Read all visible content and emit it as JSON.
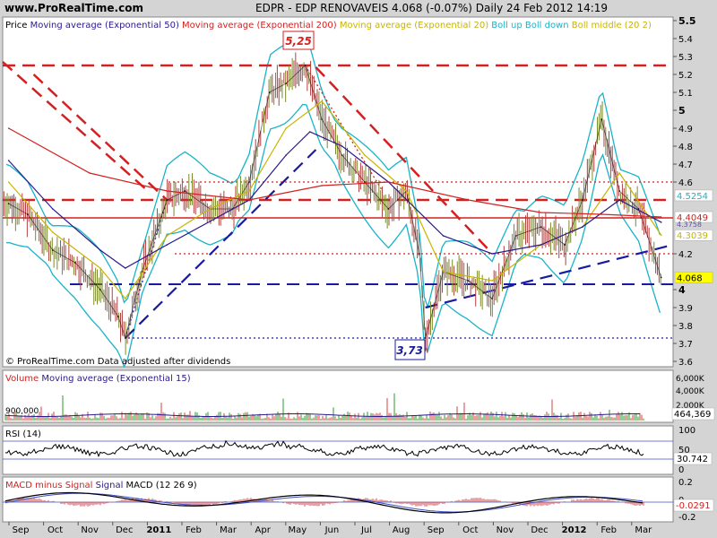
{
  "header": {
    "site": "www.ProRealTime.com",
    "title": "EDPR - EDP RENOVAVEIS    4.068 (-0.07%)    Daily  24 Feb 2012 14:19"
  },
  "price_panel": {
    "legend": [
      {
        "text": "Price",
        "color": "#000000"
      },
      {
        "text": "Moving average (Exponential 50)",
        "color": "#2a1a8a"
      },
      {
        "text": "Moving average (Exponential 200)",
        "color": "#d42020"
      },
      {
        "text": "Moving average (Exponential 20)",
        "color": "#c8b400"
      },
      {
        "text": "Boll up",
        "color": "#18b4c8"
      },
      {
        "text": "Boll down",
        "color": "#18b4c8"
      },
      {
        "text": "Boll middle (20 2)",
        "color": "#c8b400"
      }
    ],
    "footer": "© ProRealTime.com  Data adjusted after dividends",
    "annotations": {
      "high": "5,25",
      "low": "3,73"
    },
    "y_ticks": [
      "5.5",
      "5.4",
      "5.3",
      "5.2",
      "5.1",
      "5",
      "4.9",
      "4.8",
      "4.7",
      "4.6",
      "4.2",
      "4",
      "3.9",
      "3.8",
      "3.7",
      "3.6"
    ],
    "badges": [
      {
        "value": "4.5254",
        "color": "#18b4c8",
        "bg": "#ffffff"
      },
      {
        "value": "4.4049",
        "color": "#d42020",
        "bg": "#ffffff"
      },
      {
        "value": "4.3039",
        "color": "#c8b400",
        "bg": "#ffffff"
      },
      {
        "value": "4.068",
        "color": "#000000",
        "bg": "#ffff00"
      }
    ],
    "overlap_label": "4.3758"
  },
  "volume_panel": {
    "legend": [
      {
        "text": "Volume",
        "color": "#d42020"
      },
      {
        "text": "Moving average (Exponential 15)",
        "color": "#2a1a8a"
      }
    ],
    "inner_label": "900,000",
    "y_ticks": [
      "6,000K",
      "4,000K",
      "2,000K"
    ],
    "badge": "464,369"
  },
  "rsi_panel": {
    "legend": "RSI (14)",
    "y_ticks": [
      "100",
      "50",
      "0"
    ],
    "badge": "30.742"
  },
  "macd_panel": {
    "legend": [
      {
        "text": "MACD minus Signal",
        "color": "#d42020"
      },
      {
        "text": "Signal",
        "color": "#2a1a8a"
      },
      {
        "text": "MACD (12 26 9)",
        "color": "#000000"
      }
    ],
    "y_ticks": [
      "0.2",
      "0",
      "-0.2"
    ],
    "badge": "-0.0291"
  },
  "x_axis": {
    "labels": [
      "Sep",
      "Oct",
      "Nov",
      "Dec",
      "2011",
      "Feb",
      "Mar",
      "Apr",
      "May",
      "Jun",
      "Jul",
      "Aug",
      "Sep",
      "Oct",
      "Nov",
      "Dec",
      "2012",
      "Feb",
      "Mar"
    ],
    "bold": [
      "2011",
      "2012"
    ]
  },
  "chart_data": {
    "type": "line",
    "title": "EDPR - EDP RENOVAVEIS",
    "x_range": [
      "2010-08-20",
      "2012-03-05"
    ],
    "ylim": [
      3.6,
      5.5
    ],
    "series": [
      {
        "name": "Price",
        "x": [
          "2010-08-25",
          "2010-09-10",
          "2010-10-01",
          "2010-10-20",
          "2010-11-10",
          "2010-11-25",
          "2010-12-01",
          "2010-12-15",
          "2011-01-05",
          "2011-01-20",
          "2011-02-10",
          "2011-03-01",
          "2011-03-15",
          "2011-04-01",
          "2011-04-15",
          "2011-05-01",
          "2011-05-15",
          "2011-06-01",
          "2011-06-20",
          "2011-07-10",
          "2011-07-25",
          "2011-08-05",
          "2011-08-10",
          "2011-08-25",
          "2011-09-15",
          "2011-10-05",
          "2011-10-25",
          "2011-11-15",
          "2011-12-05",
          "2011-12-20",
          "2012-01-05",
          "2012-01-20",
          "2012-02-05",
          "2012-02-24"
        ],
        "values": [
          4.48,
          4.42,
          4.22,
          4.15,
          4.0,
          3.85,
          3.73,
          4.1,
          4.5,
          4.55,
          4.45,
          4.45,
          4.6,
          5.1,
          5.15,
          5.25,
          4.95,
          4.75,
          4.6,
          4.45,
          4.55,
          4.2,
          3.73,
          4.1,
          4.05,
          3.95,
          4.3,
          4.35,
          4.25,
          4.5,
          4.95,
          4.55,
          4.45,
          4.068
        ]
      },
      {
        "name": "Moving average (Exponential 20)",
        "x": [
          "2010-08-25",
          "2010-10-01",
          "2010-11-10",
          "2010-12-01",
          "2011-01-05",
          "2011-02-10",
          "2011-03-15",
          "2011-04-15",
          "2011-05-15",
          "2011-06-20",
          "2011-07-25",
          "2011-08-25",
          "2011-10-05",
          "2011-11-15",
          "2011-12-20",
          "2012-01-20",
          "2012-02-24"
        ],
        "values": [
          4.6,
          4.32,
          4.12,
          3.95,
          4.3,
          4.45,
          4.55,
          4.9,
          5.05,
          4.75,
          4.55,
          4.1,
          4.05,
          4.25,
          4.35,
          4.65,
          4.3039
        ]
      },
      {
        "name": "Moving average (Exponential 50)",
        "x": [
          "2010-08-25",
          "2010-10-01",
          "2010-11-10",
          "2010-12-01",
          "2011-01-05",
          "2011-02-10",
          "2011-03-15",
          "2011-04-15",
          "2011-05-05",
          "2011-06-01",
          "2011-07-10",
          "2011-08-25",
          "2011-10-05",
          "2011-11-15",
          "2011-12-20",
          "2012-01-20",
          "2012-02-24"
        ],
        "values": [
          4.72,
          4.45,
          4.22,
          4.12,
          4.25,
          4.38,
          4.5,
          4.75,
          4.88,
          4.8,
          4.6,
          4.3,
          4.2,
          4.25,
          4.35,
          4.5,
          4.3758
        ]
      },
      {
        "name": "Moving average (Exponential 200)",
        "x": [
          "2010-08-25",
          "2010-11-01",
          "2011-01-05",
          "2011-03-15",
          "2011-05-15",
          "2011-07-10",
          "2011-09-15",
          "2011-11-15",
          "2012-01-05",
          "2012-02-24"
        ],
        "values": [
          4.9,
          4.65,
          4.55,
          4.5,
          4.58,
          4.6,
          4.5,
          4.43,
          4.42,
          4.4049
        ]
      }
    ],
    "horizontal_levels": [
      5.25,
      4.6,
      4.5,
      4.4,
      4.2,
      4.03,
      3.73
    ],
    "annotations": [
      "5,25",
      "3,73"
    ],
    "volume": {
      "ylim_k": [
        0,
        6000
      ],
      "ema15_last": 464369
    },
    "rsi": {
      "ylim": [
        0,
        100
      ],
      "last": 30.742
    },
    "macd": {
      "ylim": [
        -0.2,
        0.2
      ],
      "last": -0.0291
    }
  }
}
